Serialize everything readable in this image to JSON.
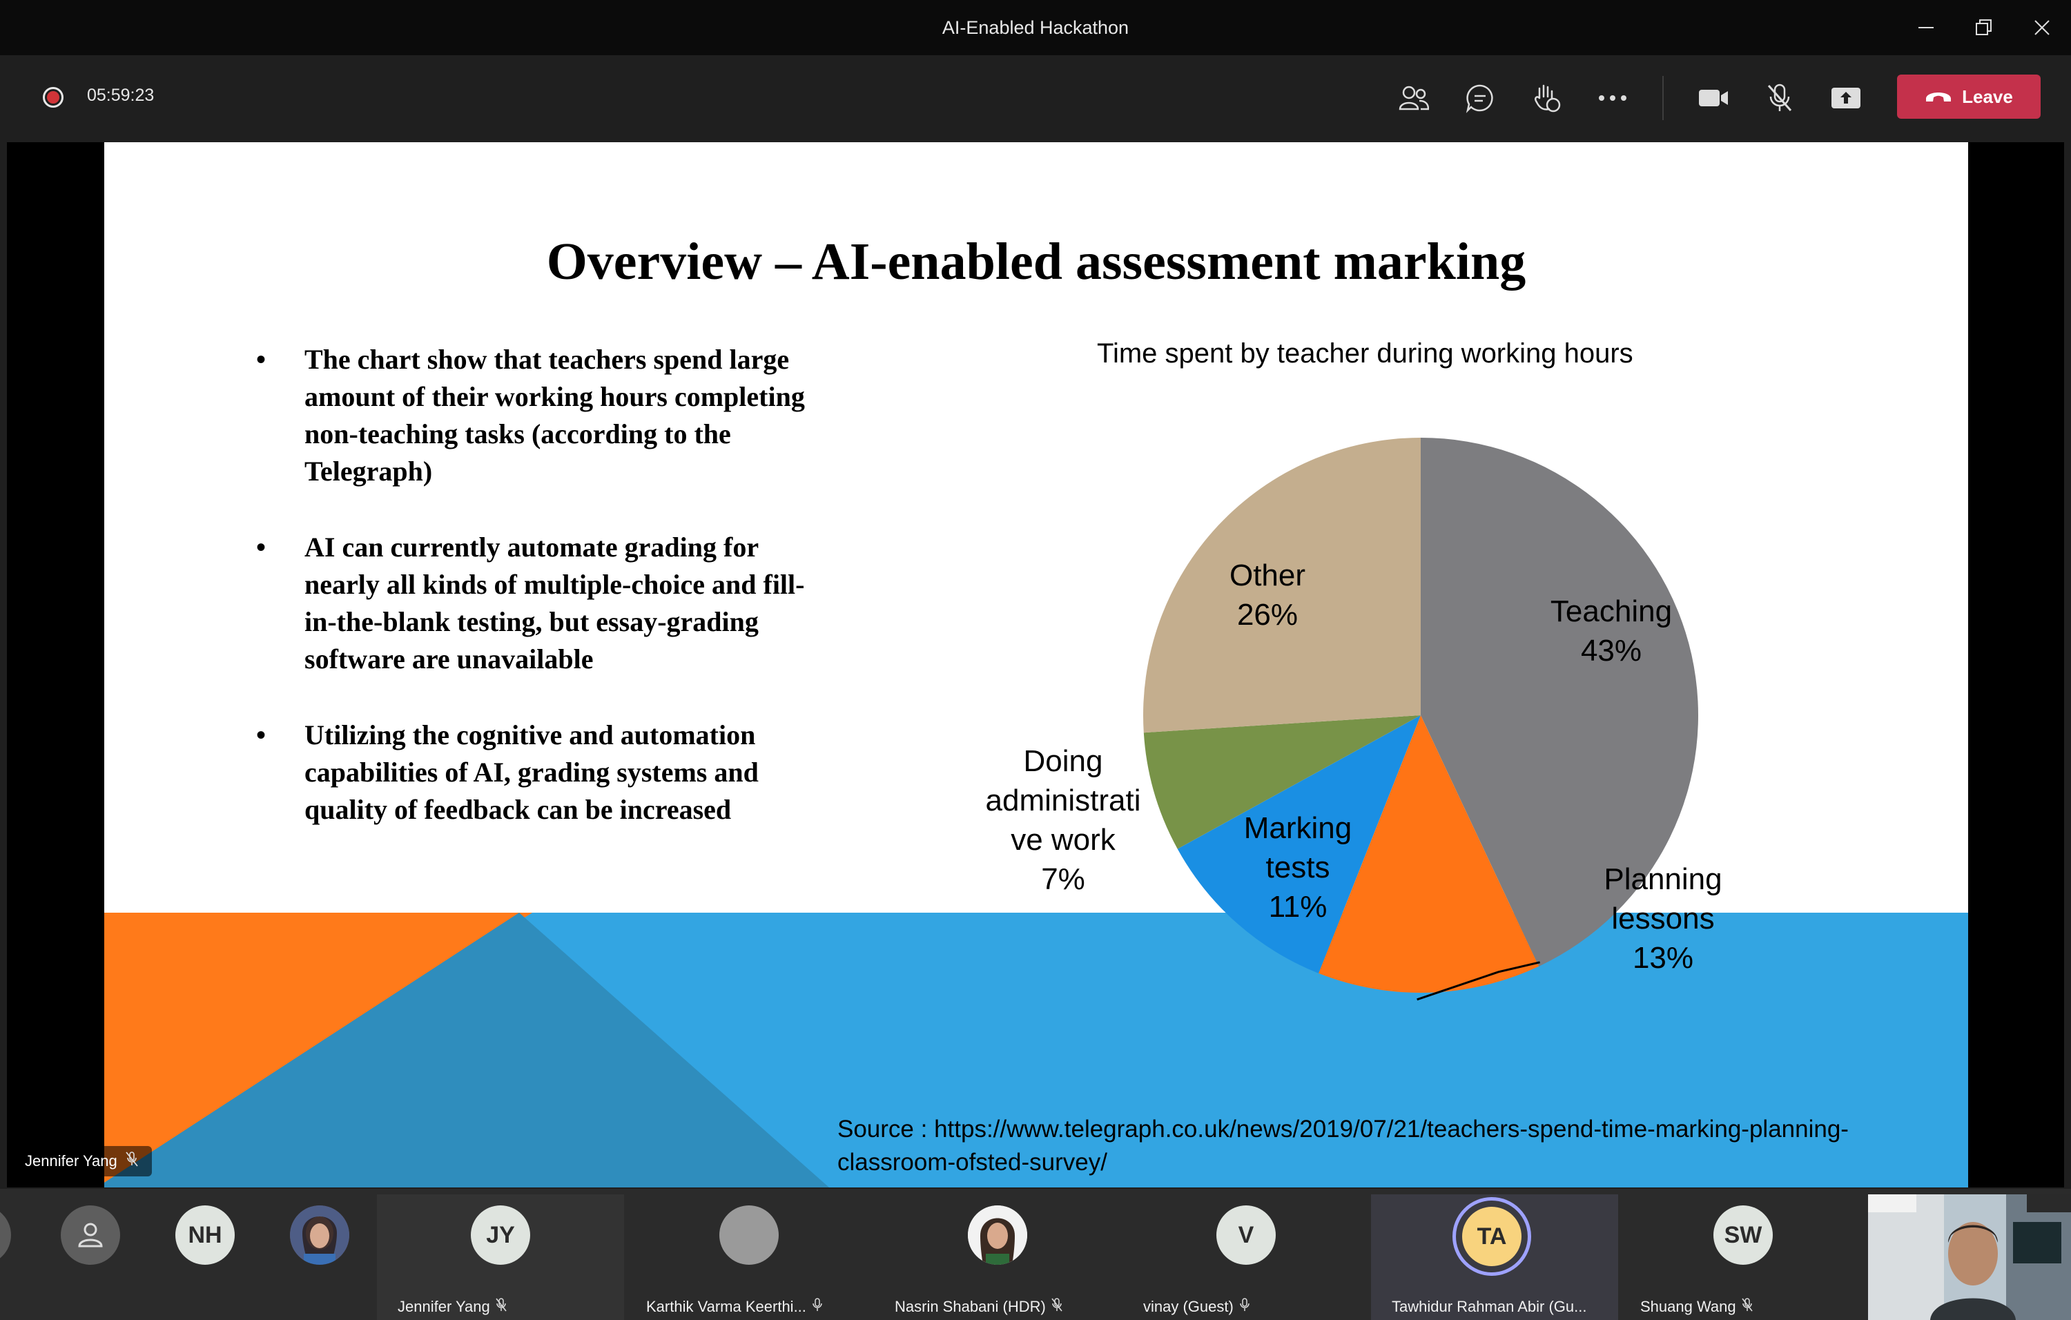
{
  "window": {
    "title": "AI-Enabled Hackathon"
  },
  "toolbar": {
    "recording_time": "05:59:23",
    "leave_label": "Leave",
    "icons": [
      "people-icon",
      "chat-icon",
      "raise-hand-icon",
      "more-icon",
      "camera-icon",
      "mic-muted-icon",
      "share-icon"
    ]
  },
  "slide": {
    "title": "Overview – AI-enabled assessment marking",
    "bullets": [
      "The chart show that teachers spend large amount of their working hours completing non-teaching tasks (according to the Telegraph)",
      " AI can currently automate grading for nearly all kinds of multiple-choice and fill-in-the-blank testing, but essay-grading software are unavailable",
      "Utilizing the cognitive and automation capabilities of AI, grading systems and quality of feedback can be increased"
    ],
    "source_label": "Source : ",
    "source_url": "https://www.telegraph.co.uk/news/2019/07/21/teachers-spend-time-marking-planning-classroom-ofsted-survey/"
  },
  "chart_data": {
    "type": "pie",
    "title": "Time spent by teacher during working hours",
    "slices": [
      {
        "label": "Teaching",
        "value": 43,
        "display": "43%",
        "color": "#7d7d80"
      },
      {
        "label": "Planning lessons",
        "value": 13,
        "display": "13%",
        "color": "#ff7415"
      },
      {
        "label": "Marking tests",
        "value": 11,
        "display": "11%",
        "color": "#1a8fe3"
      },
      {
        "label": "Doing administrative work",
        "value": 7,
        "display": "7%",
        "color": "#789348"
      },
      {
        "label": "Other",
        "value": 26,
        "display": "26%",
        "color": "#c4ae8e"
      }
    ],
    "label_text": {
      "teaching": [
        "Teaching",
        "43%"
      ],
      "planning": [
        "Planning",
        "lessons",
        "13%"
      ],
      "marking": [
        "Marking",
        "tests",
        "11%"
      ],
      "admin": [
        "Doing",
        "administrati",
        "ve work",
        "7%"
      ],
      "other": [
        "Other",
        "26%"
      ]
    }
  },
  "presenter": {
    "name": "Jennifer Yang"
  },
  "participants": [
    {
      "initials": "NH",
      "name": ""
    },
    {
      "initials": "JY",
      "name": "Jennifer Yang"
    },
    {
      "initials": "",
      "name": "Karthik Varma Keerthi..."
    },
    {
      "initials": "",
      "name": "Nasrin Shabani (HDR)"
    },
    {
      "initials": "V",
      "name": "vinay (Guest)"
    },
    {
      "initials": "TA",
      "name": "Tawhidur Rahman Abir (Gu..."
    },
    {
      "initials": "SW",
      "name": "Shuang Wang"
    }
  ]
}
